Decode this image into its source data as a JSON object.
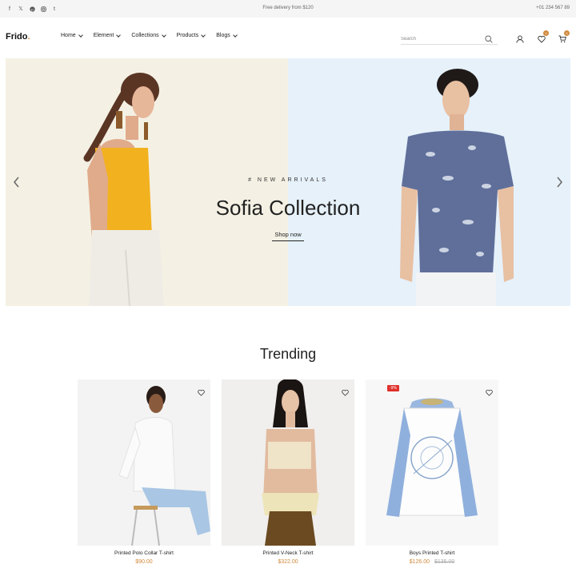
{
  "topbar": {
    "socials": [
      "facebook-icon",
      "x-icon",
      "pinterest-icon",
      "instagram-icon",
      "tumblr-icon"
    ],
    "promo": "Free delivery from $120",
    "phone": "+01 234 567 89"
  },
  "header": {
    "logo": "Frido",
    "logo_dot": ".",
    "nav": [
      "Home",
      "Element",
      "Collections",
      "Products",
      "Blogs"
    ],
    "search_placeholder": "Search",
    "wishlist_count": "0",
    "cart_count": "0"
  },
  "hero": {
    "subtitle": "# NEW ARRIVALS",
    "title": "Sofia Collection",
    "button": "Shop now"
  },
  "trending": {
    "title": "Trending",
    "products": [
      {
        "name": "Printed Polo Collar T-shirt",
        "price": "$90.00",
        "old_price": ""
      },
      {
        "name": "Printed V-Neck T-shirt",
        "price": "$322.00",
        "old_price": ""
      },
      {
        "name": "Boys Printed T-shirt",
        "price": "$126.00",
        "old_price": "$135.00",
        "badge": "-9%"
      }
    ]
  },
  "colors": {
    "accent": "#d1893a",
    "sale": "#e0302c",
    "hero_left": "#f4f1e4",
    "hero_right": "#e6f1fa"
  }
}
